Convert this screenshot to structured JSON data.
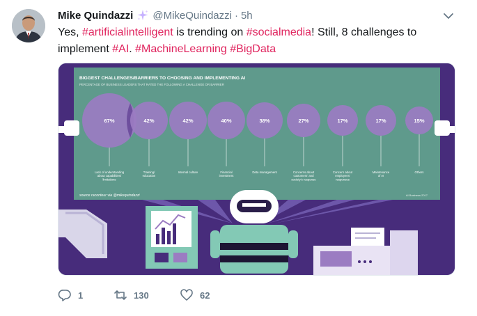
{
  "tweet": {
    "author_name": "Mike Quindazzi",
    "handle": "@MikeQuindazzi",
    "separator": "·",
    "time": "5h",
    "text": {
      "p1": "Yes, ",
      "tag1": "#artificialintelligent",
      "p2": " is trending on ",
      "tag2": "#socialmedia",
      "p3": "! Still, 8 challenges to implement ",
      "tag3": "#AI",
      "p4": ". ",
      "tag4": "#MachineLearning",
      "p5": " ",
      "tag5": "#BigData"
    },
    "replies": "1",
    "retweets": "130",
    "likes": "62"
  },
  "infographic": {
    "title": "BIGGEST CHALLENGES/BARRIERS TO CHOOSING AND IMPLEMENTING AI",
    "subtitle": "PERCENTAGE OF BUSINESS LEADERS THAT RATED THE FOLLOWING A CHALLENGE OR BARRIER",
    "source": "source raconteur via @mikequindazzi",
    "credit": "AI Business 2017",
    "items": [
      {
        "value": "67%",
        "label": [
          "Lack of understanding",
          "about capabilities/",
          "limitations"
        ]
      },
      {
        "value": "42%",
        "label": [
          "Training/",
          "education"
        ]
      },
      {
        "value": "42%",
        "label": [
          "Internal culture"
        ]
      },
      {
        "value": "40%",
        "label": [
          "Financial",
          "investment"
        ]
      },
      {
        "value": "38%",
        "label": [
          "Data management"
        ]
      },
      {
        "value": "27%",
        "label": [
          "Concerns about",
          "customers' and",
          "society's response"
        ]
      },
      {
        "value": "17%",
        "label": [
          "Concern about",
          "employees'",
          "responses"
        ]
      },
      {
        "value": "17%",
        "label": [
          "Maintenance",
          "of AI"
        ]
      },
      {
        "value": "15%",
        "label": [
          "Others"
        ]
      }
    ]
  },
  "colors": {
    "hashtag": "#e0245e",
    "muted": "#657786",
    "board": "#5f9a8c",
    "bubble": "#9b7cc2",
    "background": "#472c7b"
  },
  "icons": {
    "verified": "sparkles-icon",
    "more": "chevron-down-icon",
    "reply": "reply-icon",
    "retweet": "retweet-icon",
    "like": "heart-icon"
  }
}
